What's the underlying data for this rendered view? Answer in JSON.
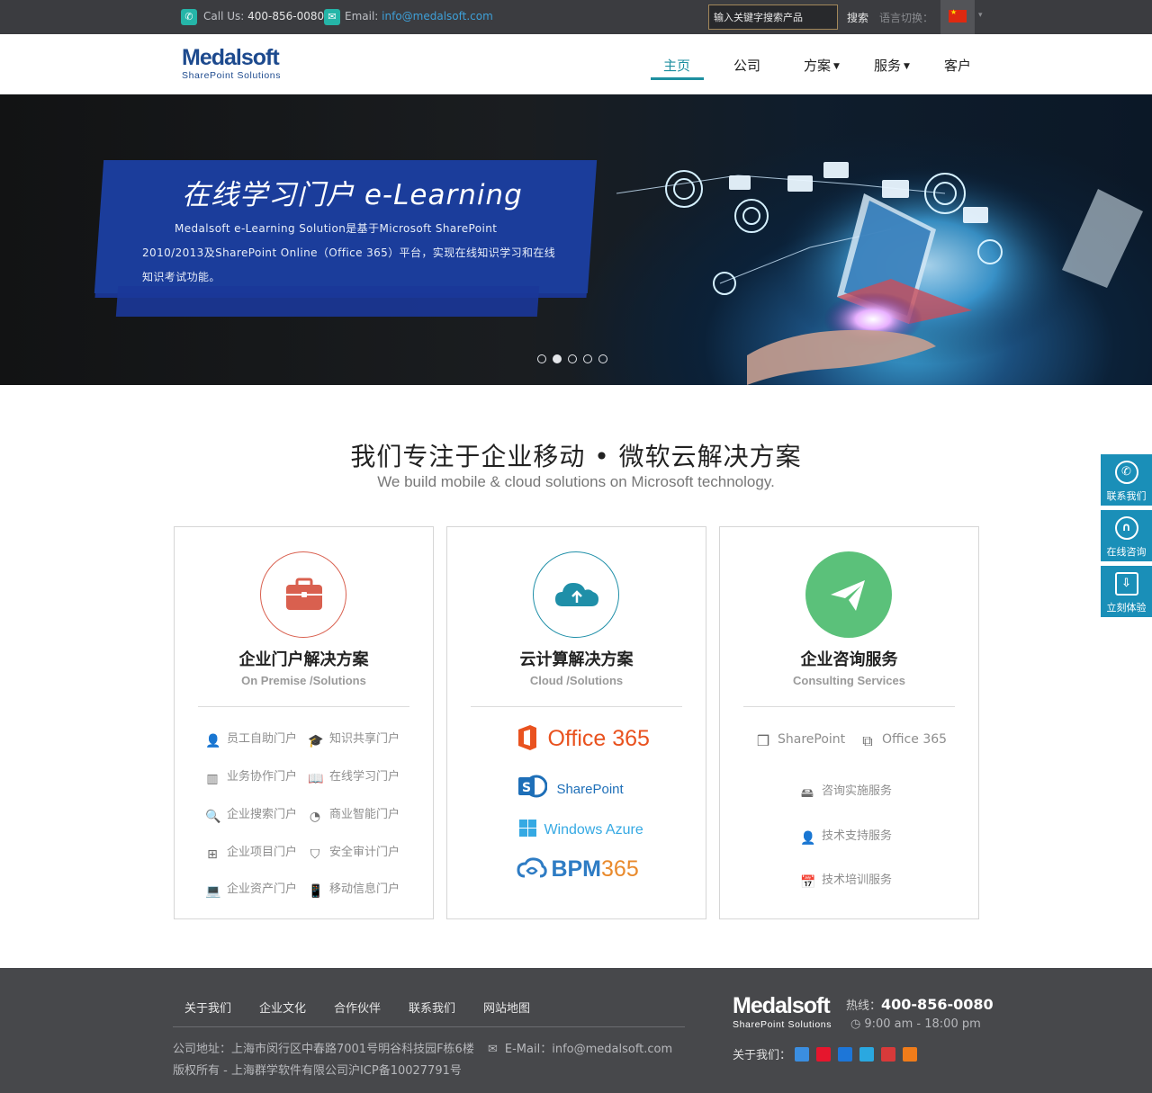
{
  "topbar": {
    "call_label": "Call Us:",
    "phone": "400-856-0080",
    "email_label": "Email:",
    "email": "info@medalsoft.com",
    "search_placeholder": "输入关键字搜索产品",
    "search_button": "搜索",
    "language_label": "语言切换：",
    "language_caret": "▾"
  },
  "header": {
    "logo_name": "Medalsoft",
    "logo_tagline": "SharePoint Solutions",
    "nav": {
      "home": "主页",
      "company": "公司",
      "solutions": "方案",
      "services": "服务",
      "clients": "客户"
    },
    "caret": "▼"
  },
  "hero": {
    "title": "在线学习门户 e-Learning",
    "desc_line1": "Medalsoft e-Learning Solution是基于Microsoft SharePoint",
    "desc_line2": "2010/2013及SharePoint Online（Office 365）平台，实现在线知识学习和在线",
    "desc_line3": "知识考试功能。",
    "slide_count": 5,
    "active_slide": 2
  },
  "intro": {
    "headline": "我们专注于企业移动 • 微软云解决方案",
    "subline": "We build mobile & cloud solutions on Microsoft technology."
  },
  "cards": {
    "premise": {
      "title": "企业门户解决方案",
      "subtitle": "On Premise /Solutions",
      "accent": "#d9604f",
      "items": [
        "员工自助门户",
        "知识共享门户",
        "业务协作门户",
        "在线学习门户",
        "企业搜索门户",
        "商业智能门户",
        "企业项目门户",
        "安全审计门户",
        "企业资产门户",
        "移动信息门户"
      ]
    },
    "cloud": {
      "title": "云计算解决方案",
      "subtitle": "Cloud /Solutions",
      "accent": "#1f8fa8",
      "brands": {
        "office365": "Office 365",
        "sharepoint": "SharePoint",
        "azure": "Windows Azure",
        "bpm_a": "BPM",
        "bpm_b": "365"
      }
    },
    "consulting": {
      "title": "企业咨询服务",
      "subtitle": "Consulting Services",
      "accent": "#5bc17a",
      "products": [
        "SharePoint",
        "Office 365"
      ],
      "services": [
        "咨询实施服务",
        "技术支持服务",
        "技术培训服务"
      ]
    }
  },
  "side": {
    "contact": "联系我们",
    "consult": "在线咨询",
    "trial": "立刻体验"
  },
  "footer": {
    "links": [
      "关于我们",
      "企业文化",
      "合作伙伴",
      "联系我们",
      "网站地图"
    ],
    "address": "公司地址：上海市闵行区中春路7001号明谷科技园F栋6楼",
    "email_text": "E-Mail：info@medalsoft.com",
    "copyright": "版权所有 - 上海群学软件有限公司沪ICP备10027791号",
    "logo_name": "Medalsoft",
    "logo_tagline": "SharePoint Solutions",
    "hotline_label": "热线：",
    "hotline": "400-856-0080",
    "hours": "9:00 am - 18:00 pm",
    "about_label": "关于我们："
  }
}
